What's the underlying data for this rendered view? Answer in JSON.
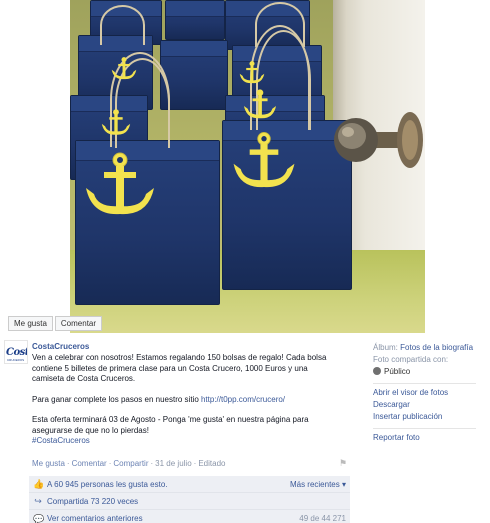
{
  "photo_actions": {
    "like": "Me gusta",
    "comment": "Comentar"
  },
  "avatar": {
    "text": "Costa",
    "sub": "CRUCEROS"
  },
  "post": {
    "page_name": "CostaCruceros",
    "lines_1": [
      "Ven a celebrar con nosotros! Estamos regalando 150 bolsas de regalo! Cada bolsa",
      "contiene 5 billetes de primera clase para un Costa Crucero, 1000 Euros y una",
      "camiseta de Costa Cruceros."
    ],
    "line_2_prefix": "Para ganar complete los pasos en nuestro sitio ",
    "line_2_link": "http://t0pp.com/crucero/",
    "lines_3": [
      "Esta oferta terminará 03 de Agosto - Ponga 'me gusta' en nuestra página para",
      "asegurarse de que no lo pierdas!"
    ],
    "hashtag": "#CostaCruceros"
  },
  "meta": {
    "like": "Me gusta",
    "comment": "Comentar",
    "share": "Compartir",
    "date": "31 de julio",
    "edited": "Editado",
    "sep": "·"
  },
  "ufi": {
    "likes": "A 60 945 personas les gusta esto.",
    "sort": "Más recientes ▾",
    "shares": "Compartida 73 220 veces",
    "view_comments": "Ver comentarios anteriores",
    "comment_count": "49 de 44 271"
  },
  "side": {
    "album_label": "Álbum:",
    "album_value": "Fotos de la biografía",
    "shared_with": "Foto compartida con:",
    "audience": "Público",
    "open_viewer": "Abrir el visor de fotos",
    "download": "Descargar",
    "insert_pub": "Insertar publicación",
    "report": "Reportar foto"
  },
  "colors": {
    "fb_blue": "#3b5998",
    "bag_navy": "#1f3569",
    "anchor_yellow": "#f2e24e"
  }
}
